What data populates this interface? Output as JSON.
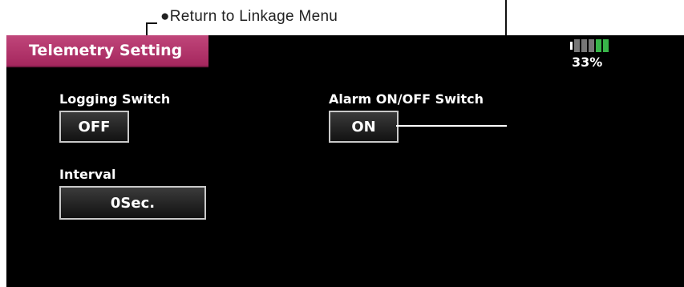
{
  "annotation": {
    "bullet": "●",
    "text": "Return to Linkage Menu"
  },
  "title": "Telemetry Setting",
  "battery": {
    "percent": "33%",
    "level": 0.33,
    "cell_colors": [
      "#777777",
      "#777777",
      "#777777",
      "#39b54a",
      "#39b54a"
    ]
  },
  "logging_switch": {
    "label": "Logging Switch",
    "value": "OFF"
  },
  "alarm_switch": {
    "label": "Alarm ON/OFF Switch",
    "value": "ON"
  },
  "interval": {
    "label": "Interval",
    "value": "0Sec."
  }
}
